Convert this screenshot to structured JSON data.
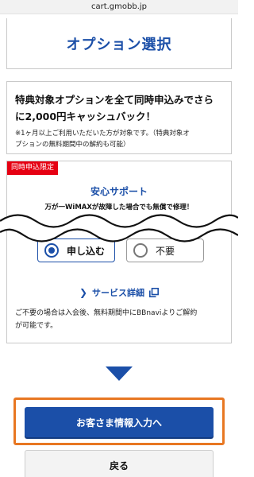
{
  "browser": {
    "url": "cart.gmobb.jp"
  },
  "header": {
    "title": "オプション選択"
  },
  "cashback": {
    "main_line1": "特典対象オプションを全て同時申込みでさら",
    "main_line2": "に2,000円キャッシュバック！",
    "note_line1": "※1ヶ月以上ご利用いただいた方が対象です。（特典対象オ",
    "note_line2": "プションの無料期間中の解約も可能）"
  },
  "option": {
    "badge": "同時申込限定",
    "name": "安心サポート",
    "description": "万が一WiMAXが故障した場合でも無償で修理！",
    "apply_label": "申し込む",
    "decline_label": "不要",
    "detail_link": "サービス詳細",
    "footnote_line1": "ご不要の場合は入会後、無料期間中にBBnaviよりご解約",
    "footnote_line2": "が可能です。"
  },
  "actions": {
    "next_label": "お客さま情報入力へ",
    "back_label": "戻る"
  },
  "colors": {
    "brand_blue": "#1b4fa8",
    "badge_red": "#e60012",
    "highlight_orange": "#e87722"
  }
}
